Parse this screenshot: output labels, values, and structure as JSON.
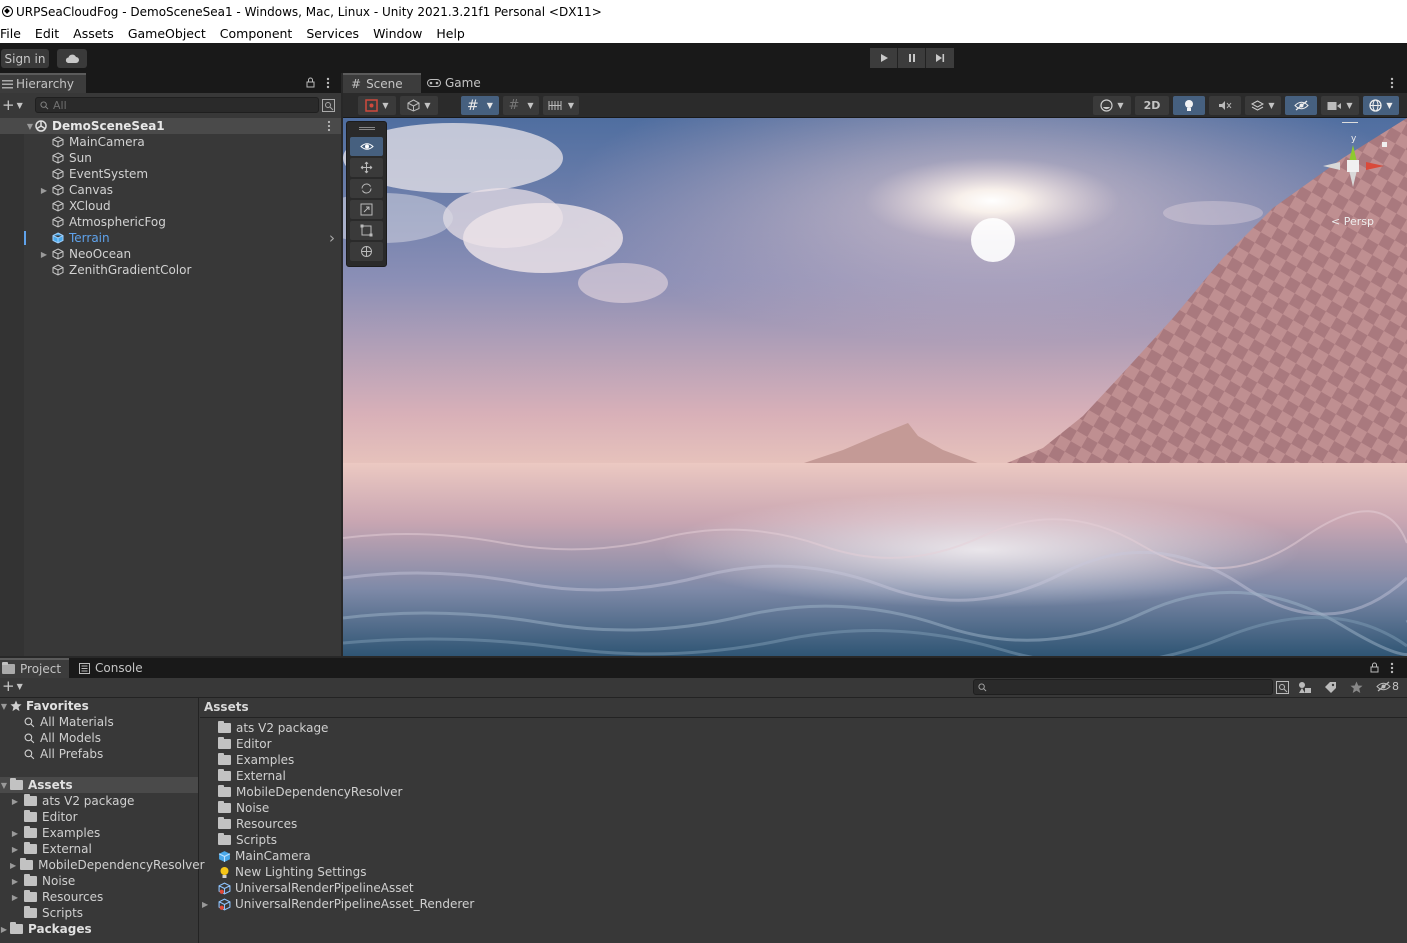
{
  "window": {
    "title": "URPSeaCloudFog - DemoSceneSea1 - Windows, Mac, Linux - Unity 2021.3.21f1 Personal <DX11>"
  },
  "menu": [
    "File",
    "Edit",
    "Assets",
    "GameObject",
    "Component",
    "Services",
    "Window",
    "Help"
  ],
  "toolbar": {
    "sign_in": "Sign in"
  },
  "hierarchy": {
    "tab_label": "Hierarchy",
    "search_placeholder": "All",
    "scene_name": "DemoSceneSea1",
    "items": [
      {
        "label": "MainCamera",
        "expandable": false,
        "selected": false
      },
      {
        "label": "Sun",
        "expandable": false,
        "selected": false
      },
      {
        "label": "EventSystem",
        "expandable": false,
        "selected": false
      },
      {
        "label": "Canvas",
        "expandable": true,
        "selected": false
      },
      {
        "label": "XCloud",
        "expandable": false,
        "selected": false
      },
      {
        "label": "AtmosphericFog",
        "expandable": false,
        "selected": false
      },
      {
        "label": "Terrain",
        "expandable": false,
        "selected": true
      },
      {
        "label": "NeoOcean",
        "expandable": true,
        "selected": false
      },
      {
        "label": "ZenithGradientColor",
        "expandable": false,
        "selected": false
      }
    ]
  },
  "scene": {
    "tabs": [
      "Scene",
      "Game"
    ],
    "btn_2d": "2D",
    "gizmo": {
      "y_label": "y",
      "persp_label": "Persp"
    }
  },
  "project": {
    "tabs": [
      "Project",
      "Console"
    ],
    "hidden_count": "8",
    "favorites_label": "Favorites",
    "favorites": [
      "All Materials",
      "All Models",
      "All Prefabs"
    ],
    "assets_root": "Assets",
    "asset_folders": [
      "ats V2 package",
      "Editor",
      "Examples",
      "External",
      "MobileDependencyResolver",
      "Noise",
      "Resources",
      "Scripts"
    ],
    "packages_label": "Packages",
    "breadcrumb": "Assets",
    "content": [
      {
        "label": "ats V2 package",
        "kind": "folder"
      },
      {
        "label": "Editor",
        "kind": "folder"
      },
      {
        "label": "Examples",
        "kind": "folder"
      },
      {
        "label": "External",
        "kind": "folder"
      },
      {
        "label": "MobileDependencyResolver",
        "kind": "folder"
      },
      {
        "label": "Noise",
        "kind": "folder"
      },
      {
        "label": "Resources",
        "kind": "folder"
      },
      {
        "label": "Scripts",
        "kind": "folder"
      },
      {
        "label": "MainCamera",
        "kind": "prefab"
      },
      {
        "label": "New Lighting Settings",
        "kind": "lighting"
      },
      {
        "label": "UniversalRenderPipelineAsset",
        "kind": "asset"
      },
      {
        "label": "UniversalRenderPipelineAsset_Renderer",
        "kind": "asset-expandable"
      }
    ]
  },
  "colors": {
    "selection": "#5fa2eb",
    "accent_blue": "#4c7fd1"
  }
}
